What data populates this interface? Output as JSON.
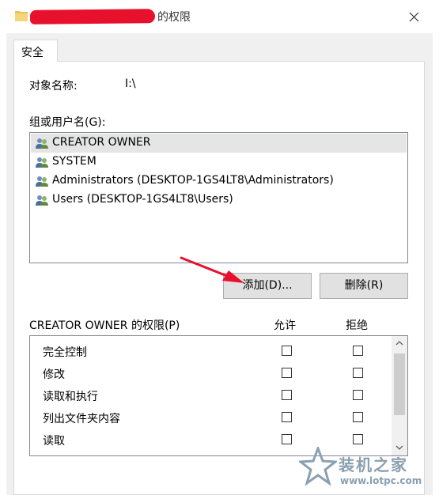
{
  "window": {
    "title_suffix": "的权限",
    "close_icon": "close-icon"
  },
  "tabs": [
    {
      "label": "安全"
    }
  ],
  "object": {
    "label": "对象名称:",
    "value": "I:\\"
  },
  "groups": {
    "label": "组或用户名(G):",
    "items": [
      {
        "label": "CREATOR OWNER",
        "selected": true
      },
      {
        "label": "SYSTEM",
        "selected": false
      },
      {
        "label": "Administrators (DESKTOP-1GS4LT8\\Administrators)",
        "selected": false
      },
      {
        "label": "Users (DESKTOP-1GS4LT8\\Users)",
        "selected": false
      }
    ]
  },
  "buttons": {
    "add": "添加(D)...",
    "remove": "删除(R)"
  },
  "permissions": {
    "label": "CREATOR OWNER 的权限(P)",
    "allow_header": "允许",
    "deny_header": "拒绝",
    "items": [
      {
        "name": "完全控制",
        "allow": false,
        "deny": false
      },
      {
        "name": "修改",
        "allow": false,
        "deny": false
      },
      {
        "name": "读取和执行",
        "allow": false,
        "deny": false
      },
      {
        "name": "列出文件夹内容",
        "allow": false,
        "deny": false
      },
      {
        "name": "读取",
        "allow": false,
        "deny": false
      }
    ]
  },
  "watermark": {
    "name": "装机之家",
    "url": "www.lotpc.com"
  },
  "colors": {
    "annotation_arrow": "#e8112d",
    "redaction": "#e8112d",
    "watermark": "#8aa0b0"
  }
}
